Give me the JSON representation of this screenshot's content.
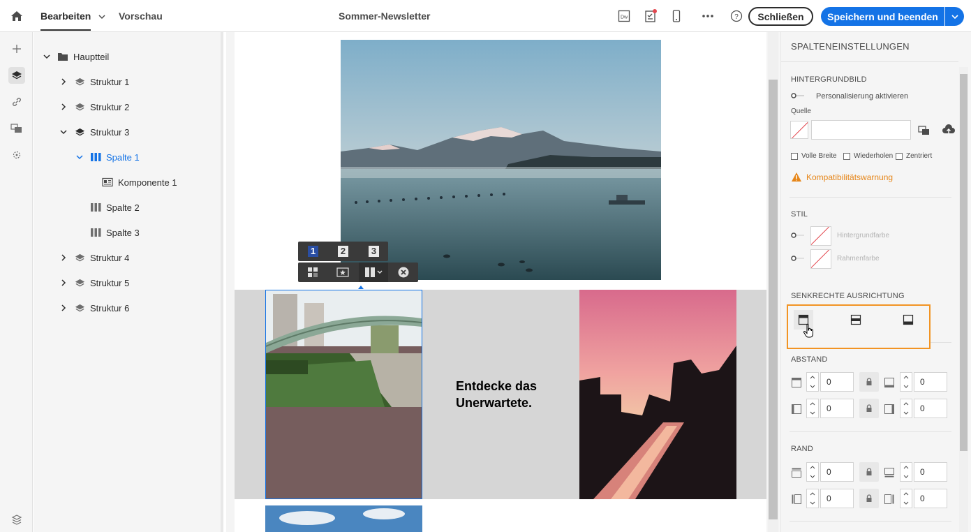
{
  "topbar": {
    "tab_edit": "Bearbeiten",
    "tab_preview": "Vorschau",
    "title": "Sommer-Newsletter",
    "close_label": "Schließen",
    "save_label": "Speichern und beenden",
    "icon_dw": "Dw"
  },
  "tree": {
    "root": "Hauptteil",
    "items": [
      {
        "label": "Struktur 1"
      },
      {
        "label": "Struktur 2"
      },
      {
        "label": "Struktur 3"
      },
      {
        "label": "Spalte 1"
      },
      {
        "label": "Komponente 1"
      },
      {
        "label": "Spalte 2"
      },
      {
        "label": "Spalte 3"
      },
      {
        "label": "Struktur 4"
      },
      {
        "label": "Struktur 5"
      },
      {
        "label": "Struktur 6"
      }
    ]
  },
  "canvas": {
    "column_buttons": [
      "1",
      "2",
      "3"
    ],
    "headline_line1": "Entdecke das",
    "headline_line2": "Unerwartete."
  },
  "panel": {
    "title": "SPALTENEINSTELLUNGEN",
    "bg_image": {
      "heading": "HINTERGRUNDBILD",
      "personalize": "Personalisierung aktivieren",
      "source": "Quelle",
      "source_value": "",
      "full_width": "Volle Breite",
      "repeat": "Wiederholen",
      "centered": "Zentriert",
      "warning": "Kompatibilitätswarnung"
    },
    "style": {
      "heading": "STIL",
      "bg_color": "Hintergrundfarbe",
      "border_color": "Rahmenfarbe"
    },
    "valign": {
      "heading": "SENKRECHTE AUSRICHTUNG"
    },
    "padding": {
      "heading": "ABSTAND",
      "top": "0",
      "bottom": "0",
      "left": "0",
      "right": "0"
    },
    "margin": {
      "heading": "RAND",
      "top": "0",
      "bottom": "0",
      "left": "0",
      "right": "0"
    }
  },
  "colors": {
    "accent": "#1473e6",
    "warning": "#e68619",
    "highlight": "#f29423"
  }
}
